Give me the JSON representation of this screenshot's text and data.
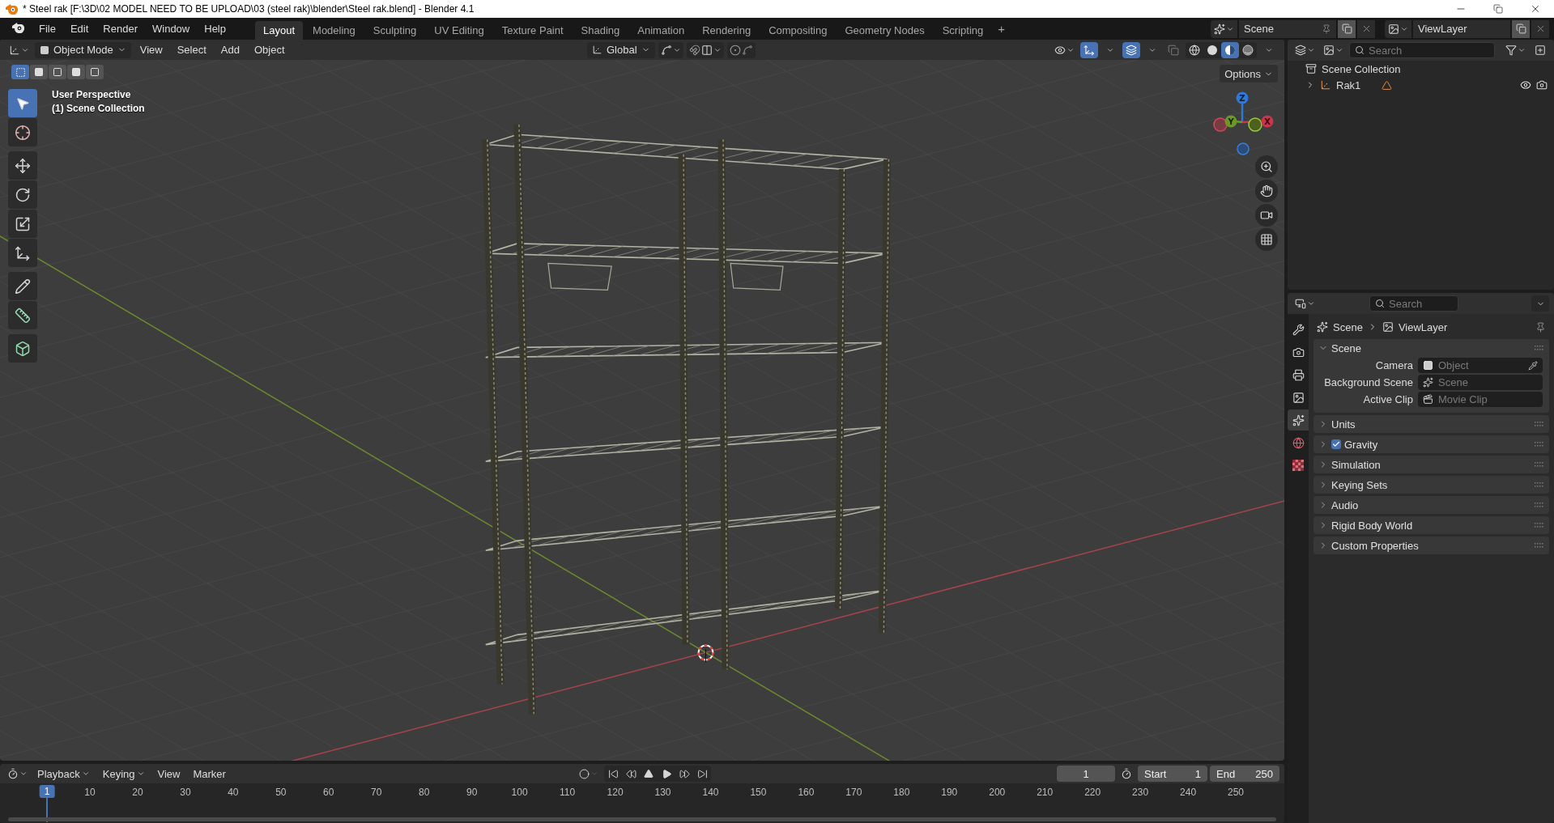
{
  "window": {
    "title": "* Steel rak [F:\\3D\\02 MODEL NEED TO BE UPLOAD\\03  (steel rak)\\blender\\Steel rak.blend] - Blender 4.1"
  },
  "menu": [
    "File",
    "Edit",
    "Render",
    "Window",
    "Help"
  ],
  "workspaces": [
    {
      "label": "Layout",
      "selected": true
    },
    {
      "label": "Modeling",
      "selected": false
    },
    {
      "label": "Sculpting",
      "selected": false
    },
    {
      "label": "UV Editing",
      "selected": false
    },
    {
      "label": "Texture Paint",
      "selected": false
    },
    {
      "label": "Shading",
      "selected": false
    },
    {
      "label": "Animation",
      "selected": false
    },
    {
      "label": "Rendering",
      "selected": false
    },
    {
      "label": "Compositing",
      "selected": false
    },
    {
      "label": "Geometry Nodes",
      "selected": false
    },
    {
      "label": "Scripting",
      "selected": false
    }
  ],
  "add_workspace": "+",
  "scene": {
    "value": "Scene"
  },
  "view_layer": {
    "value": "ViewLayer"
  },
  "viewport": {
    "mode": "Object Mode",
    "menus": [
      "View",
      "Select",
      "Add",
      "Object"
    ],
    "orientation": "Global",
    "options_label": "Options",
    "overlay_text": [
      "User Perspective",
      "(1) Scene Collection"
    ],
    "select_modes": [
      {
        "selected": true
      },
      {
        "selected": false
      },
      {
        "selected": false
      },
      {
        "selected": false
      },
      {
        "selected": false
      }
    ],
    "tools": [
      {
        "kind": "select",
        "selected": true
      },
      {
        "kind": "cursor",
        "selected": false
      },
      {
        "kind": "move",
        "selected": false
      },
      {
        "kind": "rotate",
        "selected": false
      },
      {
        "kind": "scale",
        "selected": false
      },
      {
        "kind": "transform",
        "selected": false
      },
      {
        "kind": "annotate",
        "selected": false
      },
      {
        "kind": "measure",
        "selected": false
      },
      {
        "kind": "add_cube",
        "selected": false
      }
    ],
    "shading": [
      {
        "kind": "wireframe",
        "selected": false
      },
      {
        "kind": "solid",
        "selected": false
      },
      {
        "kind": "material",
        "selected": true
      },
      {
        "kind": "rendered",
        "selected": false
      }
    ],
    "gizmo_axes": [
      "Z",
      "Y",
      "X"
    ]
  },
  "outliner": {
    "search": {
      "placeholder": "Search"
    },
    "tree": [
      {
        "label": "Scene Collection",
        "kind": "collection",
        "children": [
          {
            "label": "Rak1",
            "kind": "empty",
            "expanded": false
          }
        ]
      }
    ]
  },
  "properties": {
    "search": {
      "placeholder": "Search"
    },
    "breadcrumb": [
      "Scene",
      "ViewLayer"
    ],
    "tabs": [
      {
        "kind": "tool",
        "selected": false
      },
      {
        "kind": "render",
        "selected": false
      },
      {
        "kind": "output",
        "selected": false
      },
      {
        "kind": "view_layer",
        "selected": false
      },
      {
        "kind": "scene",
        "selected": true
      },
      {
        "kind": "world",
        "selected": false
      },
      {
        "kind": "texture",
        "selected": false
      }
    ],
    "panels": [
      {
        "title": "Scene",
        "expanded": true,
        "fields": [
          {
            "label": "Camera",
            "placeholder": "Object",
            "kind": "object"
          },
          {
            "label": "Background Scene",
            "placeholder": "Scene",
            "kind": "scene"
          },
          {
            "label": "Active Clip",
            "placeholder": "Movie Clip",
            "kind": "clip"
          }
        ]
      },
      {
        "title": "Units",
        "expanded": false
      },
      {
        "title": "Gravity",
        "expanded": false,
        "checked": true
      },
      {
        "title": "Simulation",
        "expanded": false
      },
      {
        "title": "Keying Sets",
        "expanded": false
      },
      {
        "title": "Audio",
        "expanded": false
      },
      {
        "title": "Rigid Body World",
        "expanded": false
      },
      {
        "title": "Custom Properties",
        "expanded": false
      }
    ]
  },
  "timeline": {
    "menus": [
      {
        "label": "Playback",
        "dropdown": true
      },
      {
        "label": "Keying",
        "dropdown": true
      },
      {
        "label": "View",
        "dropdown": false
      },
      {
        "label": "Marker",
        "dropdown": false
      }
    ],
    "current_frame": "1",
    "start": {
      "label": "Start",
      "value": "1"
    },
    "end": {
      "label": "End",
      "value": "250"
    },
    "ruler": [
      {
        "label": "1",
        "selected": true
      },
      {
        "label": "10",
        "selected": false
      },
      {
        "label": "20",
        "selected": false
      },
      {
        "label": "30",
        "selected": false
      },
      {
        "label": "40",
        "selected": false
      },
      {
        "label": "50",
        "selected": false
      },
      {
        "label": "60",
        "selected": false
      },
      {
        "label": "70",
        "selected": false
      },
      {
        "label": "80",
        "selected": false
      },
      {
        "label": "90",
        "selected": false
      },
      {
        "label": "100",
        "selected": false
      },
      {
        "label": "110",
        "selected": false
      },
      {
        "label": "120",
        "selected": false
      },
      {
        "label": "130",
        "selected": false
      },
      {
        "label": "140",
        "selected": false
      },
      {
        "label": "150",
        "selected": false
      },
      {
        "label": "160",
        "selected": false
      },
      {
        "label": "170",
        "selected": false
      },
      {
        "label": "180",
        "selected": false
      },
      {
        "label": "190",
        "selected": false
      },
      {
        "label": "200",
        "selected": false
      },
      {
        "label": "210",
        "selected": false
      },
      {
        "label": "220",
        "selected": false
      },
      {
        "label": "230",
        "selected": false
      },
      {
        "label": "240",
        "selected": false
      },
      {
        "label": "250",
        "selected": false
      }
    ]
  }
}
